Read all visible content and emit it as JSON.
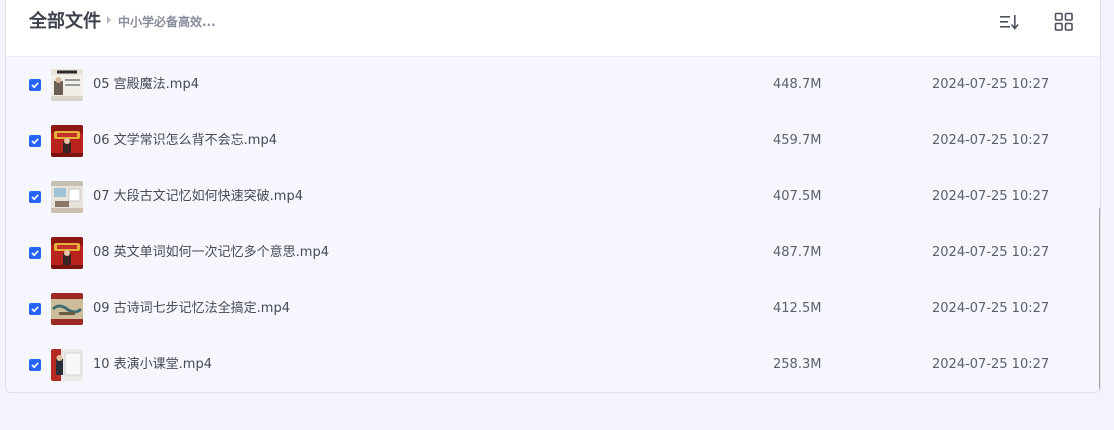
{
  "header": {
    "title": "全部文件",
    "breadcrumb": "中小学必备高效..."
  },
  "toolbar": {
    "sort_icon": "sort-icon",
    "grid_icon": "grid-view-icon"
  },
  "files": [
    {
      "name": "05 宫殿魔法.mp4",
      "size": "448.7M",
      "date": "2024-07-25 10:27",
      "checked": true
    },
    {
      "name": "06 文学常识怎么背不会忘.mp4",
      "size": "459.7M",
      "date": "2024-07-25 10:27",
      "checked": true
    },
    {
      "name": "07 大段古文记忆如何快速突破.mp4",
      "size": "407.5M",
      "date": "2024-07-25 10:27",
      "checked": true
    },
    {
      "name": "08 英文单词如何一次记忆多个意思.mp4",
      "size": "487.7M",
      "date": "2024-07-25 10:27",
      "checked": true
    },
    {
      "name": "09 古诗词七步记忆法全搞定.mp4",
      "size": "412.5M",
      "date": "2024-07-25 10:27",
      "checked": true
    },
    {
      "name": "10 表演小课堂.mp4",
      "size": "258.3M",
      "date": "2024-07-25 10:27",
      "checked": true
    }
  ],
  "colors": {
    "accent": "#2565f4",
    "background": "#f3f4fb"
  }
}
